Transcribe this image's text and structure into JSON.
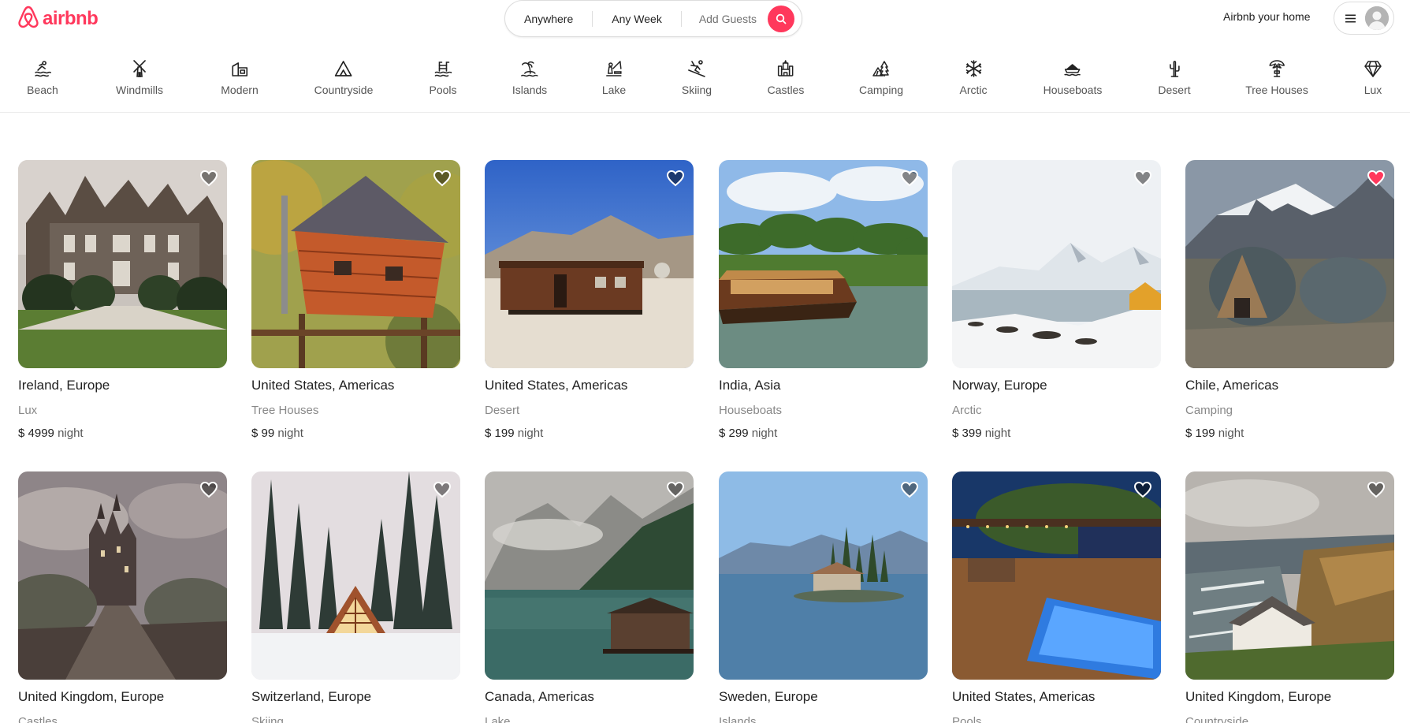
{
  "brand": {
    "name": "airbnb",
    "color": "#ff385c"
  },
  "search": {
    "where": "Anywhere",
    "when": "Any Week",
    "who": "Add Guests"
  },
  "header": {
    "host_link": "Airbnb your home"
  },
  "categories": [
    {
      "label": "Beach",
      "icon": "beach-icon"
    },
    {
      "label": "Windmills",
      "icon": "windmill-icon"
    },
    {
      "label": "Modern",
      "icon": "modern-house-icon"
    },
    {
      "label": "Countryside",
      "icon": "countryside-icon"
    },
    {
      "label": "Pools",
      "icon": "pool-icon"
    },
    {
      "label": "Islands",
      "icon": "island-icon"
    },
    {
      "label": "Lake",
      "icon": "lake-icon"
    },
    {
      "label": "Skiing",
      "icon": "skiing-icon"
    },
    {
      "label": "Castles",
      "icon": "castle-icon"
    },
    {
      "label": "Camping",
      "icon": "camping-icon"
    },
    {
      "label": "Arctic",
      "icon": "snowflake-icon"
    },
    {
      "label": "Houseboats",
      "icon": "houseboat-icon"
    },
    {
      "label": "Desert",
      "icon": "cactus-icon"
    },
    {
      "label": "Tree Houses",
      "icon": "tree-icon"
    },
    {
      "label": "Lux",
      "icon": "diamond-icon"
    }
  ],
  "listings": [
    {
      "location": "Ireland, Europe",
      "category": "Lux",
      "currency": "$",
      "price": "4999",
      "unit": "night",
      "favorited": false,
      "photo": "manor house with gardens"
    },
    {
      "location": "United States, Americas",
      "category": "Tree Houses",
      "currency": "$",
      "price": "99",
      "unit": "night",
      "favorited": false,
      "photo": "wooden treehouse"
    },
    {
      "location": "United States, Americas",
      "category": "Desert",
      "currency": "$",
      "price": "199",
      "unit": "night",
      "favorited": false,
      "photo": "railroad caboose in desert"
    },
    {
      "location": "India, Asia",
      "category": "Houseboats",
      "currency": "$",
      "price": "299",
      "unit": "night",
      "favorited": false,
      "photo": "houseboat among palms"
    },
    {
      "location": "Norway, Europe",
      "category": "Arctic",
      "currency": "$",
      "price": "399",
      "unit": "night",
      "favorited": false,
      "photo": "snowy coast"
    },
    {
      "location": "Chile, Americas",
      "category": "Camping",
      "currency": "$",
      "price": "199",
      "unit": "night",
      "favorited": true,
      "photo": "dome tents under mountains"
    },
    {
      "location": "United Kingdom, Europe",
      "category": "Castles",
      "currency": "$",
      "price": "",
      "unit": "",
      "favorited": false,
      "photo": "castle in fog"
    },
    {
      "location": "Switzerland, Europe",
      "category": "Skiing",
      "currency": "$",
      "price": "",
      "unit": "",
      "favorited": false,
      "photo": "a-frame cabin in snowy forest"
    },
    {
      "location": "Canada, Americas",
      "category": "Lake",
      "currency": "$",
      "price": "",
      "unit": "",
      "favorited": false,
      "photo": "boathouse on mountain lake"
    },
    {
      "location": "Sweden, Europe",
      "category": "Islands",
      "currency": "$",
      "price": "",
      "unit": "",
      "favorited": false,
      "photo": "small island on lake"
    },
    {
      "location": "United States, Americas",
      "category": "Pools",
      "currency": "$",
      "price": "",
      "unit": "",
      "favorited": false,
      "photo": "terrace with lit pool at night"
    },
    {
      "location": "United Kingdom, Europe",
      "category": "Countryside",
      "currency": "$",
      "price": "",
      "unit": "",
      "favorited": false,
      "photo": "cottage on coastal cliff"
    }
  ],
  "colors": {
    "accent": "#ff385c",
    "text": "#222222",
    "muted": "#888888"
  }
}
